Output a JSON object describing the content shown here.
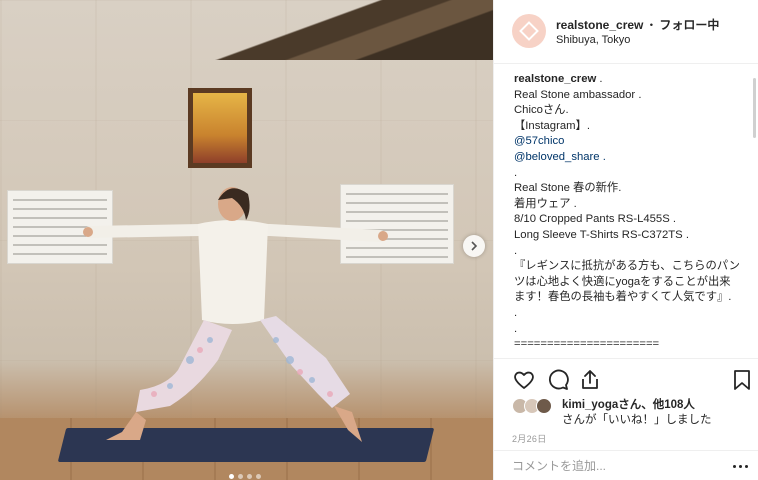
{
  "post": {
    "username": "realstone_crew",
    "separator": "・",
    "follow_status": "フォロー中",
    "location": "Shibuya, Tokyo"
  },
  "caption": {
    "username": "realstone_crew",
    "after_username": " .",
    "lines": [
      "Real Stone ambassador .",
      "Chicoさん.",
      "【Instagram】.",
      "@57chico",
      "@beloved_share .",
      ".",
      "Real Stone 春の新作.",
      "着用ウェア .",
      "8/10 Cropped Pants RS-L455S .",
      "Long Sleeve T-Shirts RS-C372TS .",
      ".",
      "『レギンスに抵抗がある方も、こちらのパンツは心地よく快適にyogaをすることが出来ます！春色の長袖も着やすくて人気です』.",
      ".",
      ".",
      "======================"
    ]
  },
  "likes": {
    "user": "kimi_yoga",
    "text1": "さん、他108人",
    "text2": "さんが「いいね！」しました"
  },
  "date": "2月26日",
  "comment": {
    "placeholder": "コメントを追加..."
  },
  "colors": {
    "accent_link": "#003569",
    "avatar_bg": "#f7d2c6",
    "mat": "#2c3652"
  },
  "icons": [
    "heart-icon",
    "comment-icon",
    "share-icon",
    "bookmark-icon",
    "chevron-right-icon",
    "more-options-icon"
  ]
}
